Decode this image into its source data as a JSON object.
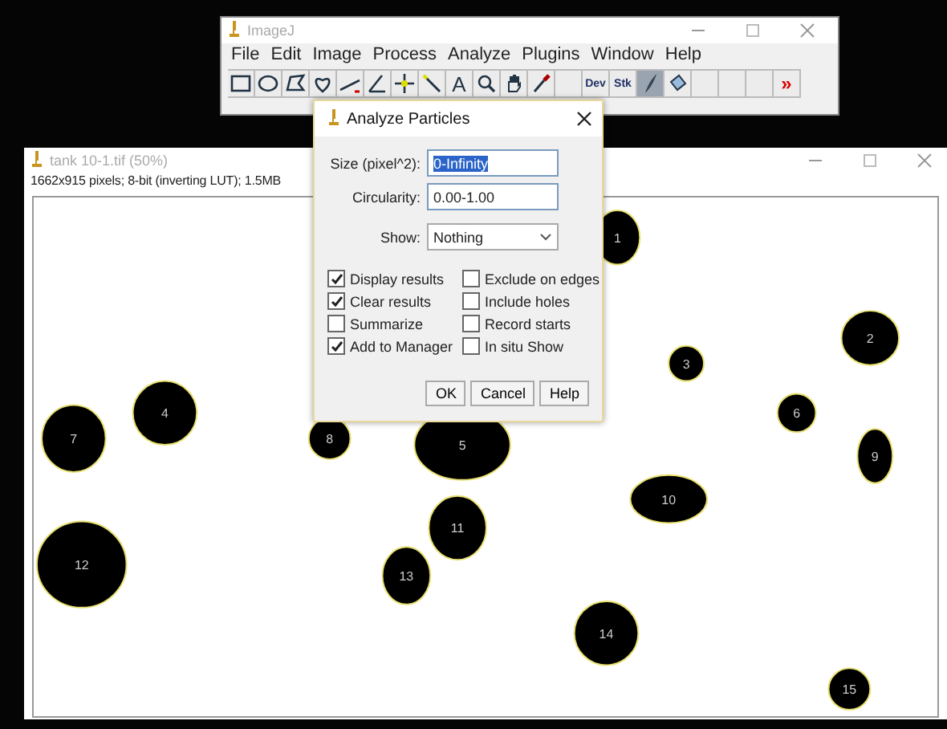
{
  "main_window": {
    "title": "ImageJ",
    "menu": [
      "File",
      "Edit",
      "Image",
      "Process",
      "Analyze",
      "Plugins",
      "Window",
      "Help"
    ],
    "tools": [
      {
        "kind": "rect",
        "selected": false
      },
      {
        "kind": "oval",
        "selected": false
      },
      {
        "kind": "polygon",
        "selected": false
      },
      {
        "kind": "freehand",
        "selected": false
      },
      {
        "kind": "line",
        "selected": false
      },
      {
        "kind": "angle",
        "selected": false
      },
      {
        "kind": "point",
        "selected": false
      },
      {
        "kind": "wand",
        "selected": false
      },
      {
        "kind": "text",
        "label": "A",
        "selected": false
      },
      {
        "kind": "zoom",
        "selected": false
      },
      {
        "kind": "hand",
        "selected": false
      },
      {
        "kind": "dropper",
        "selected": false
      },
      {
        "kind": "blank",
        "selected": false
      },
      {
        "kind": "label",
        "label": "Dev",
        "selected": false
      },
      {
        "kind": "label",
        "label": "Stk",
        "selected": false
      },
      {
        "kind": "brush",
        "selected": true
      },
      {
        "kind": "fill",
        "selected": false
      },
      {
        "kind": "blank",
        "selected": false
      },
      {
        "kind": "blank",
        "selected": false
      },
      {
        "kind": "blank",
        "selected": false
      },
      {
        "kind": "more",
        "label": "»",
        "selected": false
      }
    ]
  },
  "image_window": {
    "title": "tank 10-1.tif (50%)",
    "info": "1662x915 pixels; 8-bit (inverting LUT); 1.5MB",
    "particles": [
      {
        "label": "1"
      },
      {
        "label": "2"
      },
      {
        "label": "3"
      },
      {
        "label": "4"
      },
      {
        "label": "5"
      },
      {
        "label": "6"
      },
      {
        "label": "7"
      },
      {
        "label": "8"
      },
      {
        "label": "9"
      },
      {
        "label": "10"
      },
      {
        "label": "11"
      },
      {
        "label": "12"
      },
      {
        "label": "13"
      },
      {
        "label": "14"
      },
      {
        "label": "15"
      }
    ]
  },
  "dialog": {
    "title": "Analyze Particles",
    "fields": [
      {
        "label": "Size (pixel^2):",
        "value": "0-Infinity",
        "selected": true
      },
      {
        "label": "Circularity:",
        "value": "0.00-1.00",
        "selected": false
      }
    ],
    "show": {
      "label": "Show:",
      "value": "Nothing"
    },
    "checkboxes": [
      {
        "label": "Display results",
        "checked": true
      },
      {
        "label": "Exclude on edges",
        "checked": false
      },
      {
        "label": "Clear results",
        "checked": true
      },
      {
        "label": "Include holes",
        "checked": false
      },
      {
        "label": "Summarize",
        "checked": false
      },
      {
        "label": "Record starts",
        "checked": false
      },
      {
        "label": "Add to Manager",
        "checked": true
      },
      {
        "label": "In situ Show",
        "checked": false
      }
    ],
    "buttons": [
      "OK",
      "Cancel",
      "Help"
    ]
  }
}
